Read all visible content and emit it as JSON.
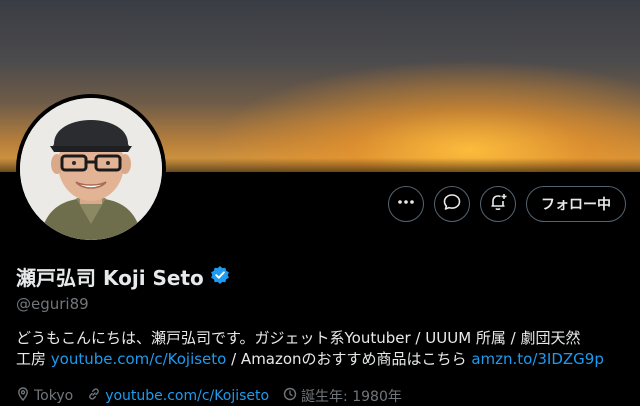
{
  "profile": {
    "display_name": "瀬戸弘司 Koji Seto",
    "handle": "@eguri89",
    "bio": {
      "line1": "どうもこんにちは、瀬戸弘司です。ガジェット系Youtuber / UUUM 所属 / 劇団天然",
      "line2_prefix": "工房 ",
      "link1": "youtube.com/c/Kojiseto",
      "line2_mid": "  / Amazonのおすすめ商品はこちら ",
      "link2": "amzn.to/3IDZG9p"
    },
    "meta": {
      "location": "Tokyo",
      "website": "youtube.com/c/Kojiseto",
      "birth": "誕生年: 1980年"
    }
  },
  "actions": {
    "follow_label": "フォロー中"
  },
  "icons": [
    "more-icon",
    "message-icon",
    "notification-bell-icon",
    "verified-badge-icon",
    "location-icon",
    "link-icon",
    "birthday-icon"
  ],
  "colors": {
    "accent": "#1d9bf0",
    "background": "#000000",
    "muted": "#71767b"
  }
}
